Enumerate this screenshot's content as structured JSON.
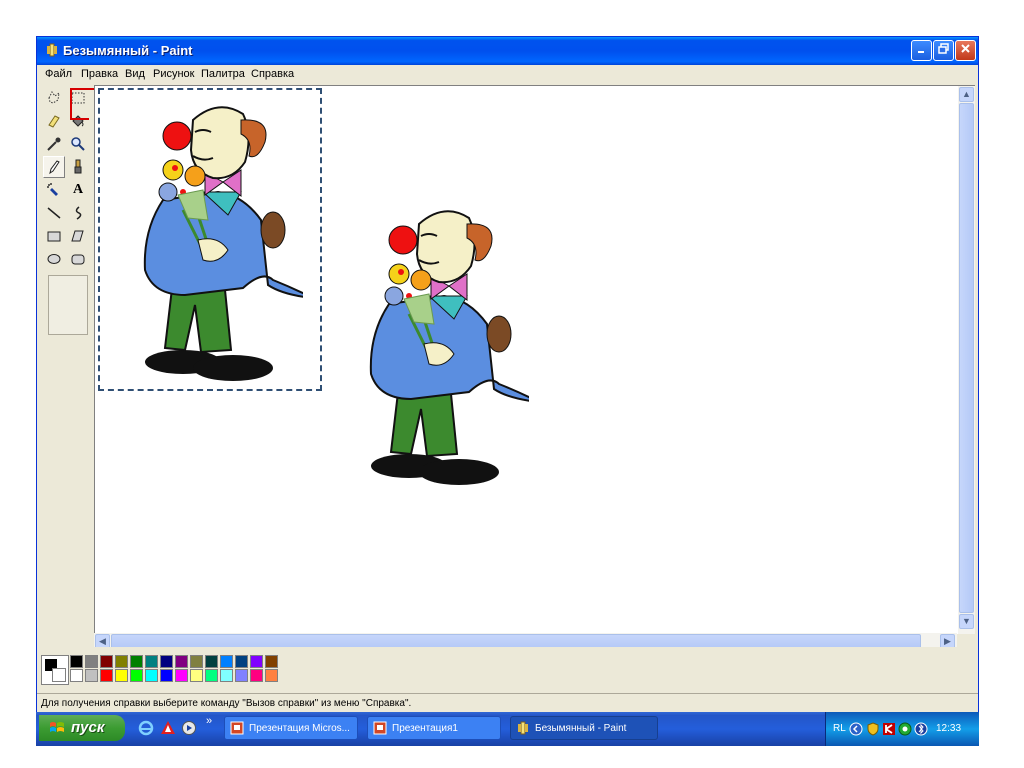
{
  "window": {
    "title": "Безымянный - Paint",
    "controls": [
      "minimize",
      "restore",
      "close"
    ]
  },
  "menu": [
    "Файл",
    "Правка",
    "Вид",
    "Рисунок",
    "Палитра",
    "Справка"
  ],
  "toolbox": {
    "tools": [
      {
        "name": "free-form-select-icon"
      },
      {
        "name": "rect-select-icon"
      },
      {
        "name": "eraser-icon"
      },
      {
        "name": "fill-icon"
      },
      {
        "name": "color-picker-icon"
      },
      {
        "name": "magnifier-icon"
      },
      {
        "name": "pencil-icon",
        "active": true
      },
      {
        "name": "brush-icon"
      },
      {
        "name": "airbrush-icon"
      },
      {
        "name": "text-icon",
        "glyph": "A"
      },
      {
        "name": "line-icon"
      },
      {
        "name": "curve-icon"
      },
      {
        "name": "rectangle-icon"
      },
      {
        "name": "polygon-icon"
      },
      {
        "name": "ellipse-icon"
      },
      {
        "name": "rounded-rect-icon"
      }
    ],
    "highlight_marker": "rect-select-icon"
  },
  "canvas": {
    "images": [
      "clown-image-selected",
      "clown-image-copy"
    ]
  },
  "palette": {
    "foreground": "#000000",
    "background": "#ffffff",
    "row1": [
      "#000000",
      "#808080",
      "#800000",
      "#808000",
      "#008000",
      "#008080",
      "#000080",
      "#800080",
      "#808040",
      "#004040",
      "#0080ff",
      "#004080",
      "#8000ff",
      "#804000"
    ],
    "row2": [
      "#ffffff",
      "#c0c0c0",
      "#ff0000",
      "#ffff00",
      "#00ff00",
      "#00ffff",
      "#0000ff",
      "#ff00ff",
      "#ffff80",
      "#00ff80",
      "#80ffff",
      "#8080ff",
      "#ff0080",
      "#ff8040"
    ]
  },
  "status": {
    "text": "Для получения справки выберите команду \"Вызов справки\" из меню \"Справка\"."
  },
  "taskbar": {
    "start_label": "пуск",
    "chevron": "»",
    "tasks": [
      {
        "label": "Презентация Micros...",
        "active": false
      },
      {
        "label": "Презентация1",
        "active": false
      },
      {
        "label": "Безымянный - Paint",
        "active": true
      }
    ],
    "tray": {
      "lang": "RL",
      "clock": "12:33"
    }
  }
}
